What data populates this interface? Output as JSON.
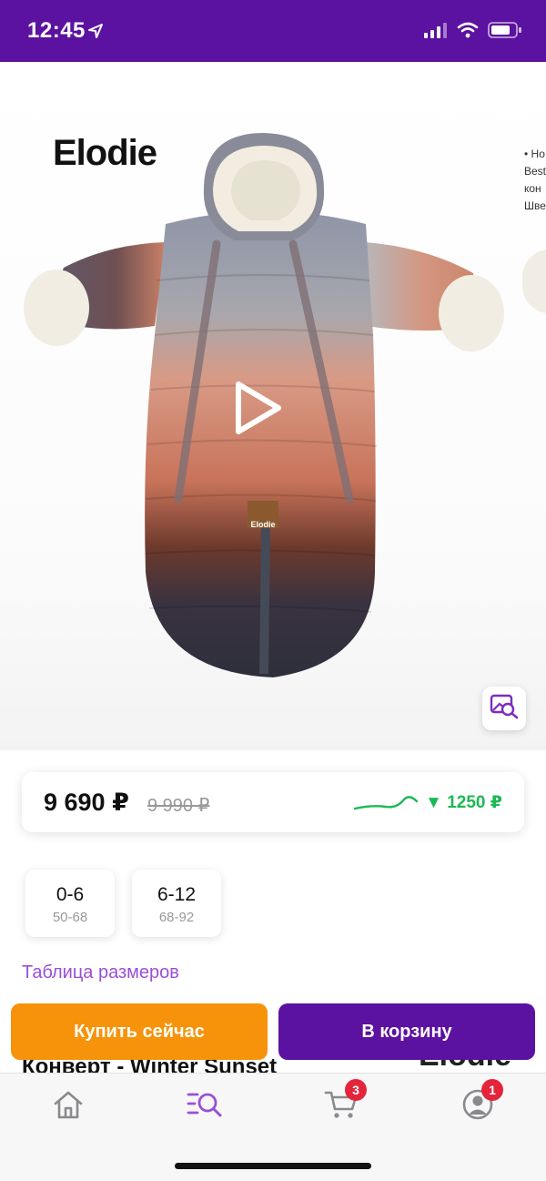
{
  "status_bar": {
    "time": "12:45",
    "background": "#5c12a0"
  },
  "product": {
    "brand_logo": "Elodie",
    "garment_label": "Elodie",
    "next_slide_text": [
      "• Ho",
      "Best",
      "кон",
      "Шве"
    ],
    "title_peek": "Конверт - Winter Sunset",
    "logo_peek": "Elodie"
  },
  "icons": {
    "back": "chevron-left-icon",
    "favorite": "heart-icon",
    "share": "share-icon",
    "play": "play-icon",
    "photo_search": "image-search-icon"
  },
  "price": {
    "current": "9 690 ₽",
    "old": "9 990 ₽",
    "drop": "▼ 1250 ₽",
    "trend_color": "#1db954"
  },
  "sizes": [
    {
      "label": "0-6",
      "range": "50-68"
    },
    {
      "label": "6-12",
      "range": "68-92"
    }
  ],
  "size_table_link": "Таблица размеров",
  "actions": {
    "buy_now": "Купить сейчас",
    "add_to_cart": "В корзину",
    "buy_color": "#f6930a",
    "cart_color": "#5c12a0"
  },
  "tab_bar": {
    "items": [
      {
        "name": "home",
        "icon": "home-icon",
        "active": false
      },
      {
        "name": "catalog-search",
        "icon": "list-search-icon",
        "active": true
      },
      {
        "name": "cart",
        "icon": "cart-icon",
        "active": false,
        "badge": "3"
      },
      {
        "name": "profile",
        "icon": "user-icon",
        "active": false,
        "badge": "1"
      }
    ],
    "active_color": "#9a4fd6"
  }
}
